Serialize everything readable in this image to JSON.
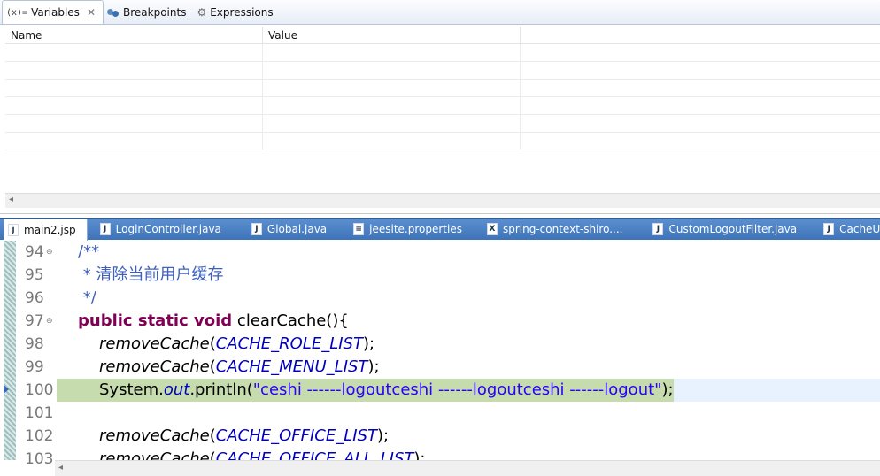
{
  "debug_view": {
    "tabs": [
      {
        "label": "Variables",
        "icon": "variables-icon",
        "icon_text": "(x)="
      },
      {
        "label": "Breakpoints",
        "icon": "breakpoints-icon"
      },
      {
        "label": "Expressions",
        "icon": "expressions-icon"
      }
    ],
    "columns": [
      "Name",
      "Value"
    ]
  },
  "editor": {
    "tabs": [
      {
        "label": "main2.jsp",
        "icon": "jsp-file-icon",
        "glyph": "j"
      },
      {
        "label": "LoginController.java",
        "icon": "java-file-icon",
        "glyph": "J"
      },
      {
        "label": "Global.java",
        "icon": "java-file-icon",
        "glyph": "J"
      },
      {
        "label": "jeesite.properties",
        "icon": "properties-file-icon",
        "glyph": "≡"
      },
      {
        "label": "spring-context-shiro....",
        "icon": "xml-file-icon",
        "glyph": "X"
      },
      {
        "label": "CustomLogoutFilter.java",
        "icon": "java-file-icon",
        "glyph": "J"
      },
      {
        "label": "CacheUtils.java",
        "icon": "java-file-icon",
        "glyph": "J"
      }
    ],
    "line_numbers": [
      "94",
      "95",
      "96",
      "97",
      "98",
      "99",
      "100",
      "101",
      "102",
      "103"
    ],
    "code": {
      "l94": "/**",
      "l95": " * 清除当前用户缓存",
      "l96": " */",
      "l97_kw": "public static void",
      "l97_rest": " clearCache(){",
      "l98_fn": "removeCache",
      "l98_arg": "CACHE_ROLE_LIST",
      "l99_fn": "removeCache",
      "l99_arg": "CACHE_MENU_LIST",
      "l100_sys": "System.",
      "l100_out": "out",
      "l100_println": ".println(",
      "l100_str": "\"ceshi ------logoutceshi ------logoutceshi ------logout\"",
      "l100_end": ");",
      "l102_fn": "removeCache",
      "l102_arg": "CACHE_OFFICE_LIST",
      "l103_fn": "removeCache",
      "l103_arg": "CACHE_OFFICE_ALL_LIST",
      "open_paren": "(",
      "close_semi": ");"
    }
  }
}
